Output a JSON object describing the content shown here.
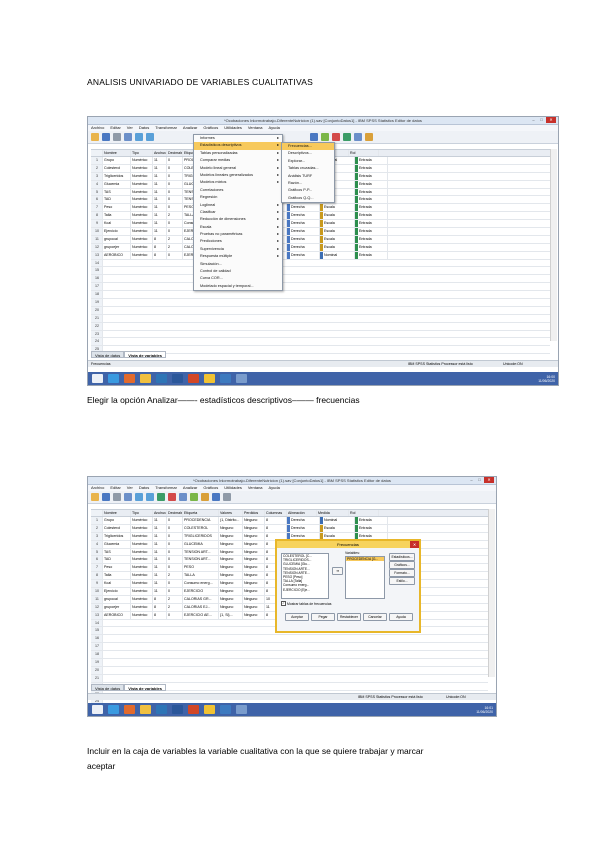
{
  "heading": "ANALISIS UNIVARIADO DE VARIABLES CUALITATIVAS",
  "caption1": "Elegir la opción Analizar——- estadísticos descriptivos–—— frecuencias",
  "caption2_line1": "Incluir en la caja de variables la variable cualitativa con la que se quiere trabajar y marcar",
  "caption2_line2": "aceptar",
  "spss": {
    "title1": "*Ocobaciones Inlormotrabajo-DiferenteNutricion (1).sav [ConjuntoDatos1] - IBM SPSS Statistics Editor de datos",
    "title2": "*Ocobaciones Inlormotrabajo-DiferenteNutricion (1).sav [ConjuntoDatos1] - IBM SPSS Statistics Editor de datos",
    "menus": [
      "Archivo",
      "Editar",
      "Ver",
      "Datos",
      "Transformar",
      "Analizar",
      "Gráficos",
      "Utilidades",
      "Ventana",
      "Ayuda"
    ],
    "columns": [
      "Nombre",
      "Tipo",
      "Anchura",
      "Decimales",
      "Etiqueta",
      "Valores",
      "Perdidos",
      "Columnas",
      "Alineación",
      "Medida",
      "Rol"
    ],
    "rows": [
      {
        "n": "1",
        "name": "Grupo",
        "type": "Numérico",
        "w": "11",
        "d": "0",
        "label": "PROCEDENCIA",
        "val": "(1, Distrito...",
        "mis": "Ninguno",
        "col": "8",
        "align": "Derecha",
        "measure": "Nominal",
        "role": "Entrada"
      },
      {
        "n": "2",
        "name": "Colesterol",
        "type": "Numérico",
        "w": "11",
        "d": "0",
        "label": "COLESTEROL",
        "val": "Ninguno",
        "mis": "Ninguno",
        "col": "8",
        "align": "Derecha",
        "measure": "Escala",
        "role": "Entrada"
      },
      {
        "n": "3",
        "name": "Trigliceridos",
        "type": "Numérico",
        "w": "11",
        "d": "0",
        "label": "TRIGLICERIDOS",
        "val": "Ninguno",
        "mis": "Ninguno",
        "col": "8",
        "align": "Derecha",
        "measure": "Escala",
        "role": "Entrada"
      },
      {
        "n": "4",
        "name": "Glucemia",
        "type": "Numérico",
        "w": "11",
        "d": "0",
        "label": "GLUCEMIA",
        "val": "Ninguno",
        "mis": "Ninguno",
        "col": "8",
        "align": "Derecha",
        "measure": "Escala",
        "role": "Entrada"
      },
      {
        "n": "5",
        "name": "TAS",
        "type": "Numérico",
        "w": "11",
        "d": "0",
        "label": "TENSION ART...",
        "val": "Ninguno",
        "mis": "Ninguno",
        "col": "8",
        "align": "Derecha",
        "measure": "Escala",
        "role": "Entrada"
      },
      {
        "n": "6",
        "name": "TAD",
        "type": "Numérico",
        "w": "11",
        "d": "0",
        "label": "TENSION ART...",
        "val": "Ninguno",
        "mis": "Ninguno",
        "col": "8",
        "align": "Derecha",
        "measure": "Escala",
        "role": "Entrada"
      },
      {
        "n": "7",
        "name": "Peso",
        "type": "Numérico",
        "w": "11",
        "d": "0",
        "label": "PESO",
        "val": "Ninguno",
        "mis": "Ninguno",
        "col": "8",
        "align": "Derecha",
        "measure": "Escala",
        "role": "Entrada"
      },
      {
        "n": "8",
        "name": "Talla",
        "type": "Numérico",
        "w": "11",
        "d": "2",
        "label": "TALLA",
        "val": "Ninguno",
        "mis": "Ninguno",
        "col": "8",
        "align": "Derecha",
        "measure": "Escala",
        "role": "Entrada"
      },
      {
        "n": "9",
        "name": "Kcal",
        "type": "Numérico",
        "w": "11",
        "d": "0",
        "label": "Consumo energ...",
        "val": "Ninguno",
        "mis": "Ninguno",
        "col": "8",
        "align": "Derecha",
        "measure": "Escala",
        "role": "Entrada"
      },
      {
        "n": "10",
        "name": "Ejercicio",
        "type": "Numérico",
        "w": "11",
        "d": "0",
        "label": "EJERCICIO",
        "val": "Ninguno",
        "mis": "Ninguno",
        "col": "8",
        "align": "Derecha",
        "measure": "Escala",
        "role": "Entrada"
      },
      {
        "n": "11",
        "name": "grupocal",
        "type": "Numérico",
        "w": "8",
        "d": "2",
        "label": "CALORIAS GR...",
        "val": "Ninguno",
        "mis": "Ninguno",
        "col": "10",
        "align": "Derecha",
        "measure": "Escala",
        "role": "Entrada"
      },
      {
        "n": "12",
        "name": "grupoejer",
        "type": "Numérico",
        "w": "8",
        "d": "2",
        "label": "CALORIAS EJ...",
        "val": "Ninguno",
        "mis": "Ninguno",
        "col": "11",
        "align": "Derecha",
        "measure": "Escala",
        "role": "Entrada"
      },
      {
        "n": "13",
        "name": "AEROBICO",
        "type": "Numérico",
        "w": "8",
        "d": "0",
        "label": "EJERCICIO AE...",
        "val": "{1, Si}...",
        "mis": "Ninguno",
        "col": "8",
        "align": "Derecha",
        "measure": "Nominal",
        "role": "Entrada"
      }
    ],
    "empty_rows": [
      "14",
      "15",
      "16",
      "17",
      "18",
      "19",
      "20",
      "21",
      "22",
      "23",
      "24",
      "25"
    ],
    "tab_data": "Vista de datos",
    "tab_vars": "Vista de variables",
    "status_left1": "Frecuencias",
    "status_mid": "IBM SPSS Statistics Processor está listo",
    "status_right": "Unicode:ON",
    "clock1_time": "16:00",
    "clock1_date": "11/06/2020",
    "clock2_time": "16:01",
    "clock2_date": "11/06/2020",
    "analyze_menu": [
      "Informes",
      "Estadísticos descriptivos",
      "Tablas personalizadas",
      "Comparar medias",
      "Modelo lineal general",
      "Modelos lineales generalizados",
      "Modelos mixtos",
      "Correlaciones",
      "Regresión",
      "Loglineal",
      "Clasificar",
      "Reducción de dimensiones",
      "Escala",
      "Pruebas no paramétricas",
      "Predicciones",
      "Supervivencia",
      "Respuesta múltiple",
      "Simulación...",
      "Control de calidad",
      "Curva COR...",
      "Modelado espacial y temporal..."
    ],
    "desc_menu": [
      "Frecuencias...",
      "Descriptivos...",
      "Explorar...",
      "Tablas cruzadas...",
      "Análisis TURF",
      "Razón...",
      "Gráficos P-P...",
      "Gráficos Q-Q..."
    ],
    "dialog": {
      "title": "Frecuencias",
      "source": [
        "COLESTEROL [C...",
        "TRIGLICERIDOS...",
        "GLUCEMIA [Glu...",
        "TENSION ARTE...",
        "TENSION ARTE...",
        "PESO [Peso]",
        "TALLA [Talla]",
        "Consumo energ...",
        "EJERCICIO [Eje..."
      ],
      "target_label": "Variables:",
      "target": [
        "PROCEDENCIA [G..."
      ],
      "side_buttons": [
        "Estadísticos...",
        "Gráficos...",
        "Formato...",
        "Estilo..."
      ],
      "checkbox": "Mostrar tablas de frecuencias",
      "bottom_buttons": [
        "Aceptar",
        "Pegar",
        "Restablecer",
        "Cancelar",
        "Ayuda"
      ]
    }
  }
}
